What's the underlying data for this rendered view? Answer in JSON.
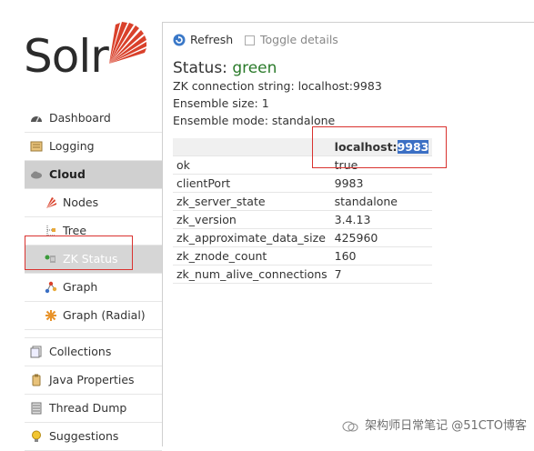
{
  "logo": {
    "text": "Solr",
    "accent": "#d9412b"
  },
  "sidebar": {
    "items": [
      {
        "label": "Dashboard",
        "icon": "dashboard-icon"
      },
      {
        "label": "Logging",
        "icon": "logging-icon"
      },
      {
        "label": "Cloud",
        "icon": "cloud-icon"
      },
      {
        "label": "Nodes",
        "icon": "nodes-icon"
      },
      {
        "label": "Tree",
        "icon": "tree-icon"
      },
      {
        "label": "ZK Status",
        "icon": "zk-status-icon"
      },
      {
        "label": "Graph",
        "icon": "graph-icon"
      },
      {
        "label": "Graph (Radial)",
        "icon": "graph-radial-icon"
      },
      {
        "label": "Collections",
        "icon": "collections-icon"
      },
      {
        "label": "Java Properties",
        "icon": "java-properties-icon"
      },
      {
        "label": "Thread Dump",
        "icon": "thread-dump-icon"
      },
      {
        "label": "Suggestions",
        "icon": "suggestions-icon"
      }
    ]
  },
  "toolbar": {
    "refresh_label": "Refresh",
    "toggle_label": "Toggle details"
  },
  "status": {
    "prefix": "Status:",
    "value": "green",
    "connection": "ZK connection string: localhost:9983",
    "ensemble_size": "Ensemble size: 1",
    "ensemble_mode": "Ensemble mode: standalone"
  },
  "zk_table": {
    "host_prefix": "localhost:",
    "host_port": "9983",
    "rows": [
      {
        "key": "ok",
        "value": "true"
      },
      {
        "key": "clientPort",
        "value": "9983"
      },
      {
        "key": "zk_server_state",
        "value": "standalone"
      },
      {
        "key": "zk_version",
        "value": "3.4.13"
      },
      {
        "key": "zk_approximate_data_size",
        "value": "425960"
      },
      {
        "key": "zk_znode_count",
        "value": "160"
      },
      {
        "key": "zk_num_alive_connections",
        "value": "7"
      }
    ]
  },
  "watermark": {
    "text": "架构师日常笔记 @51CTO博客"
  }
}
